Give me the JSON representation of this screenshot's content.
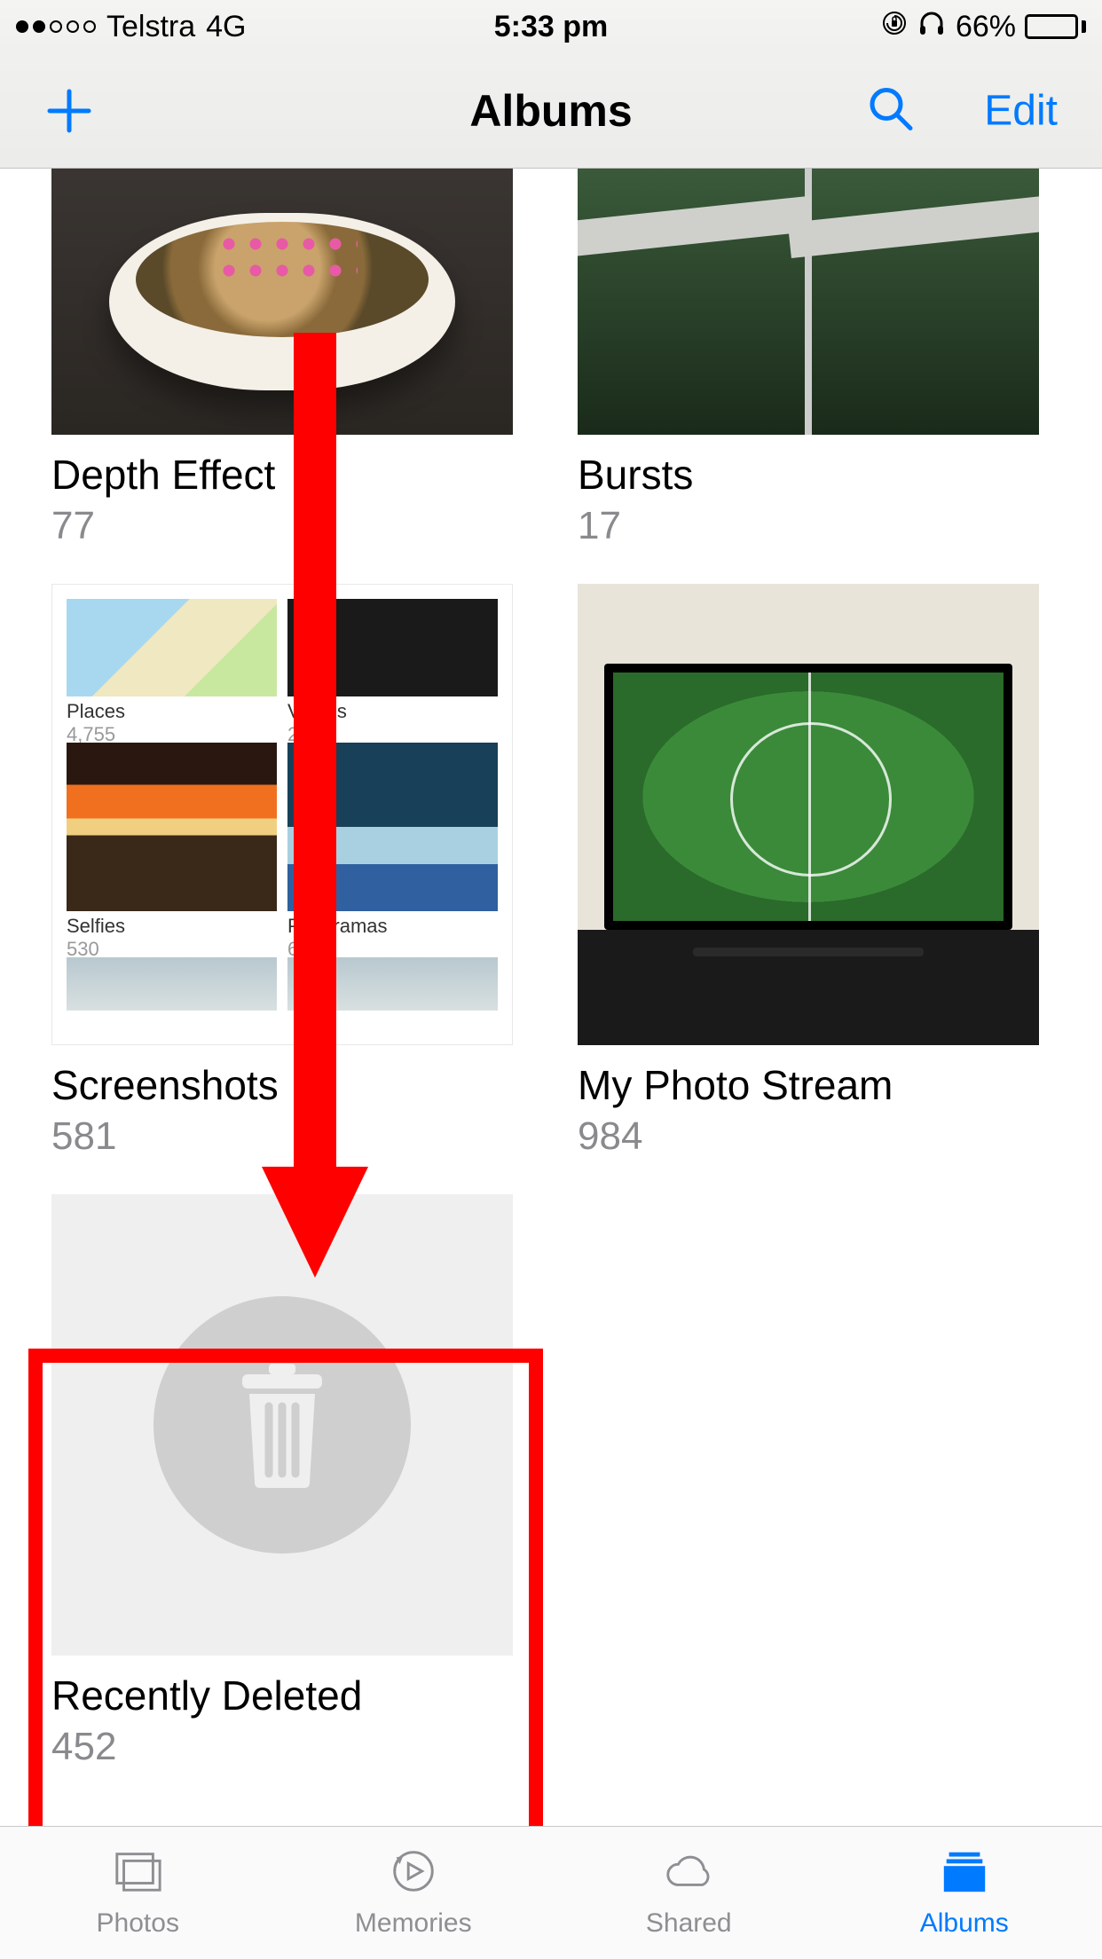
{
  "status_bar": {
    "carrier": "Telstra",
    "network": "4G",
    "time": "5:33 pm",
    "battery_percent": "66%"
  },
  "nav": {
    "title": "Albums",
    "edit": "Edit"
  },
  "albums": {
    "depth_effect": {
      "title": "Depth Effect",
      "count": "77"
    },
    "bursts": {
      "title": "Bursts",
      "count": "17"
    },
    "screenshots": {
      "title": "Screenshots",
      "count": "581",
      "tiles": {
        "places": {
          "label": "Places",
          "count": "4,755"
        },
        "videos": {
          "label": "Videos",
          "count": "222"
        },
        "selfies": {
          "label": "Selfies",
          "count": "530"
        },
        "panoramas": {
          "label": "Panoramas",
          "count": "6"
        }
      }
    },
    "photo_stream": {
      "title": "My Photo Stream",
      "count": "984"
    },
    "recently_deleted": {
      "title": "Recently Deleted",
      "count": "452"
    }
  },
  "tabs": {
    "photos": "Photos",
    "memories": "Memories",
    "shared": "Shared",
    "albums": "Albums"
  }
}
